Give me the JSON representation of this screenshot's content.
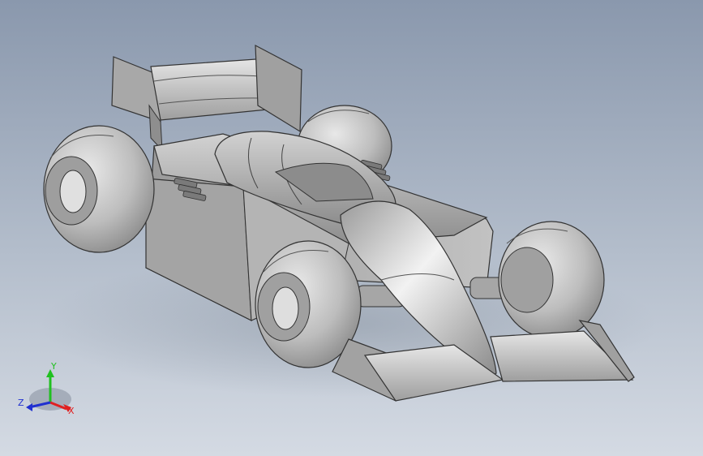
{
  "viewport": {
    "background_top": "#8a98ad",
    "background_bottom": "#d4dae3",
    "model": "f1-race-car"
  },
  "triad": {
    "x_label": "X",
    "y_label": "Y",
    "z_label": "Z",
    "x_color": "#e02020",
    "y_color": "#20c020",
    "z_color": "#2030d0"
  }
}
